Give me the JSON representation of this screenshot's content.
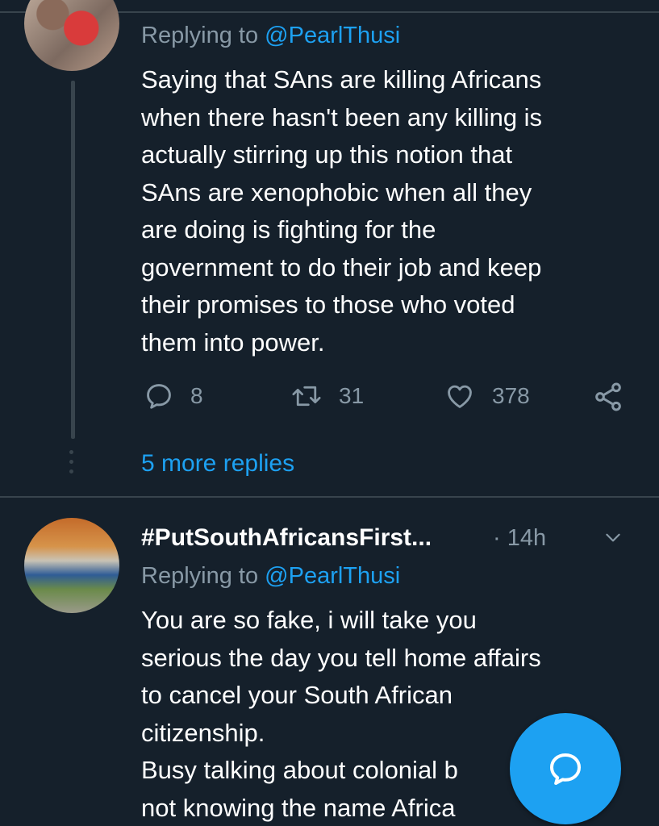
{
  "tweet1": {
    "replying_prefix": "Replying to ",
    "replying_handle": "@PearlThusi",
    "text": "Saying that SAns are killing Africans\nwhen there hasn't been any killing is\nactually stirring up this notion that\nSAns are xenophobic when all they\nare doing is fighting for the\ngovernment to do their job and keep\ntheir promises to those who voted\nthem into power.",
    "reply_count": "8",
    "retweet_count": "31",
    "like_count": "378",
    "more_replies": "5 more replies"
  },
  "tweet2": {
    "author_name": "#PutSouthAfricansFirst...",
    "time": "· 14h",
    "replying_prefix": "Replying to ",
    "replying_handle": "@PearlThusi",
    "text": "You are so fake, i will take you\nserious the day you tell home affairs\nto cancel your South African\ncitizenship.\nBusy talking about colonial b\nnot knowing the name Africa"
  },
  "icons": {
    "reply": "reply-icon",
    "retweet": "retweet-icon",
    "like": "heart-icon",
    "share": "share-icon",
    "menu": "chevron-down-icon",
    "compose": "compose-reply-icon"
  },
  "colors": {
    "background": "#15202b",
    "accent": "#1da1f2",
    "muted": "#8899a6",
    "divider": "#38444d"
  }
}
